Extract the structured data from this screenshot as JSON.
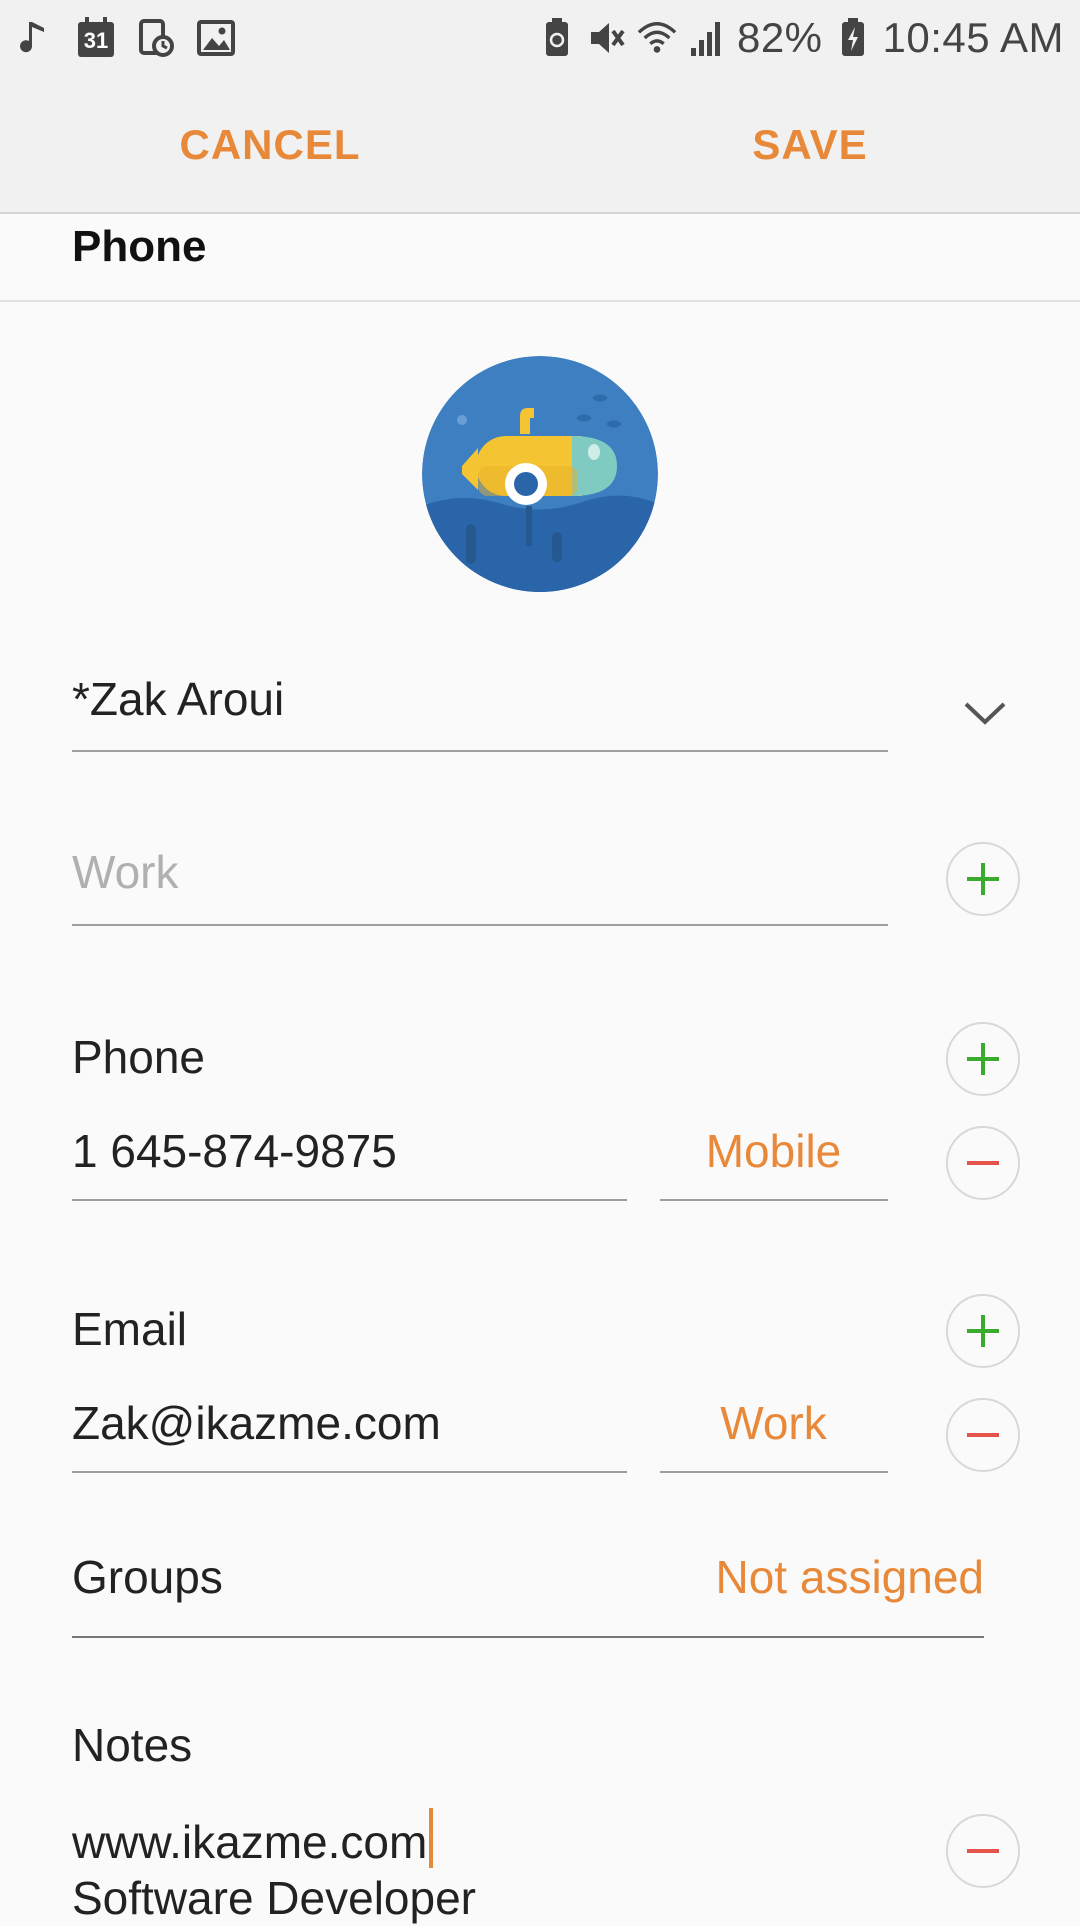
{
  "status_bar": {
    "battery_percent": "82%",
    "time": "10:45 AM",
    "left_icons": [
      "music-note-icon",
      "calendar-icon",
      "screenshot-icon",
      "gallery-icon"
    ],
    "right_icons": [
      "battery-saver-icon",
      "mute-icon",
      "wifi-icon",
      "signal-icon",
      "battery-charging-icon"
    ],
    "calendar_day": "31"
  },
  "action_bar": {
    "cancel_label": "CANCEL",
    "save_label": "SAVE"
  },
  "section": {
    "title": "Phone"
  },
  "form": {
    "name_value": "*Zak Aroui",
    "company_placeholder": "Work",
    "phone": {
      "label": "Phone",
      "value": "1 645-874-9875",
      "type": "Mobile"
    },
    "email": {
      "label": "Email",
      "value": "Zak@ikazme.com",
      "type": "Work"
    },
    "groups": {
      "label": "Groups",
      "value": "Not assigned"
    },
    "notes": {
      "label": "Notes",
      "line1": "www.ikazme.com",
      "line2": "Software Developer"
    }
  },
  "colors": {
    "accent": "#e8893a",
    "add_green": "#3aab2f",
    "remove_red": "#e5534b",
    "avatar_bg": "#3d7fc1"
  }
}
